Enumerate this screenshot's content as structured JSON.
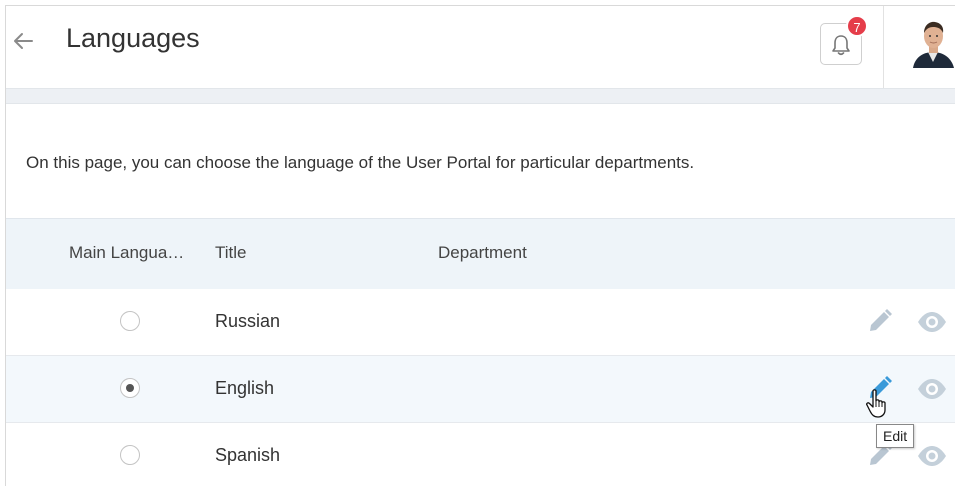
{
  "header": {
    "title": "Languages",
    "notifications_count": "7"
  },
  "intro_text": "On this page, you can choose the language of the User Portal for particular departments.",
  "table": {
    "columns": {
      "main_language": "Main Langua…",
      "title": "Title",
      "department": "Department"
    },
    "rows": [
      {
        "title": "Russian",
        "department": "",
        "main": false
      },
      {
        "title": "English",
        "department": "",
        "main": true
      },
      {
        "title": "Spanish",
        "department": "",
        "main": false
      }
    ]
  },
  "tooltip": {
    "edit": "Edit"
  },
  "colors": {
    "accent_blue": "#3a9ad9",
    "icon_gray": "#b9c6d2",
    "badge_red": "#e53d4a",
    "header_row_bg": "#eef4f9"
  },
  "icons": [
    "back-arrow-icon",
    "bell-icon",
    "pencil-icon",
    "eye-icon",
    "hand-cursor-icon"
  ]
}
